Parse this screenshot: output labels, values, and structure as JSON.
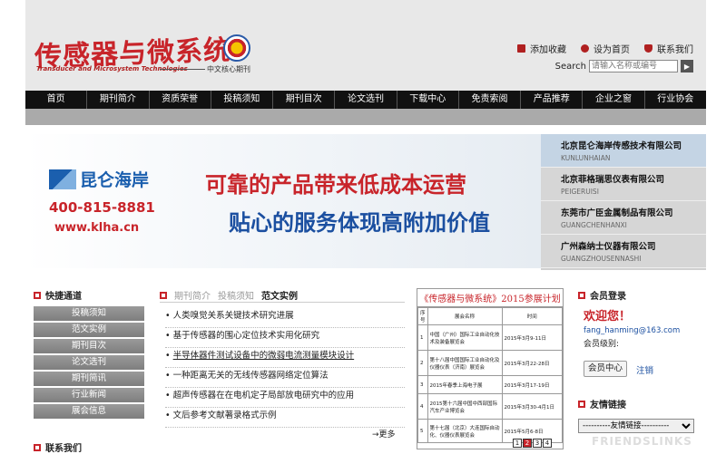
{
  "header": {
    "logo_cn": "传感器与微系统",
    "logo_en": "Transducer and Microsystem Technologies",
    "logo_sub": "中文核心期刊",
    "links": [
      "添加收藏",
      "设为首页",
      "联系我们"
    ],
    "search_label": "Search",
    "search_placeholder": "请输入名称或编号"
  },
  "nav": [
    "首页",
    "期刊简介",
    "资质荣誉",
    "投稿须知",
    "期刊目次",
    "论文选刊",
    "下载中心",
    "免责索阅",
    "产品推荐",
    "企业之窗",
    "行业协会"
  ],
  "banner": {
    "brand": "昆仑海岸",
    "phone": "400-815-8881",
    "url": "www.klha.cn",
    "slogan1": "可靠的产品带来低成本运营",
    "slogan2": "贴心的服务体现高附加价值"
  },
  "companies": [
    {
      "cn": "北京昆仑海岸传感技术有限公司",
      "en": "KUNLUNHAIAN"
    },
    {
      "cn": "北京菲格瑞思仪表有限公司",
      "en": "PEIGERUISI"
    },
    {
      "cn": "东莞市广臣金属制品有限公司",
      "en": "GUANGCHENHANXI"
    },
    {
      "cn": "广州森纳士仪器有限公司",
      "en": "GUANGZHOUSENNASHI"
    }
  ],
  "quick": {
    "title": "快捷通道",
    "items": [
      "投稿须知",
      "范文实例",
      "期刊目次",
      "论文选刊",
      "期刊简讯",
      "行业新闻",
      "展会信息"
    ],
    "contact_title": "联系我们"
  },
  "tabs": [
    "期刊简介",
    "投稿须知",
    "范文实例"
  ],
  "articles": [
    "人类嗅觉关系关键技术研究进展",
    "基于传感器的围心定位技术实用化研究",
    "半导体器件测试设备中的微弱电流测量模块设计",
    "一种距离无关的无线传感器网络定位算法",
    "超声传感器在在电机定子局部放电研究中的应用",
    "文后参考文献著录格式示例"
  ],
  "more": "→更多",
  "expo": {
    "title": "《传感器与微系统》2015参展计划",
    "headers": [
      "序号",
      "展会名称",
      "时间"
    ],
    "rows": [
      [
        "1",
        "中国（广州）国际工业自动化技术及装备展览会",
        "2015年3月9-11日"
      ],
      [
        "2",
        "第十八届中国国际工业自动化及仪器仪表（济南）展览会",
        "2015年3月22-28日"
      ],
      [
        "3",
        "2015年春季上海电子展",
        "2015年3月17-19日"
      ],
      [
        "4",
        "2015第十六届中国中西部国际汽车产业博览会",
        "2015年3月30-4月1日"
      ],
      [
        "5",
        "第十七届（北京）大连国际自动化、仪器仪表展览会",
        "2015年5月6-8日"
      ]
    ],
    "pages": [
      "1",
      "2",
      "3",
      "4"
    ]
  },
  "member": {
    "title": "会员登录",
    "welcome": "欢迎您！",
    "email": "fang_hanming@163.com",
    "level": "会员级别:",
    "center_btn": "会员中心",
    "logout": "注销"
  },
  "friends": {
    "title": "友情链接",
    "select": "----------友情链接----------",
    "watermark": "FRIENDSLINKS"
  }
}
